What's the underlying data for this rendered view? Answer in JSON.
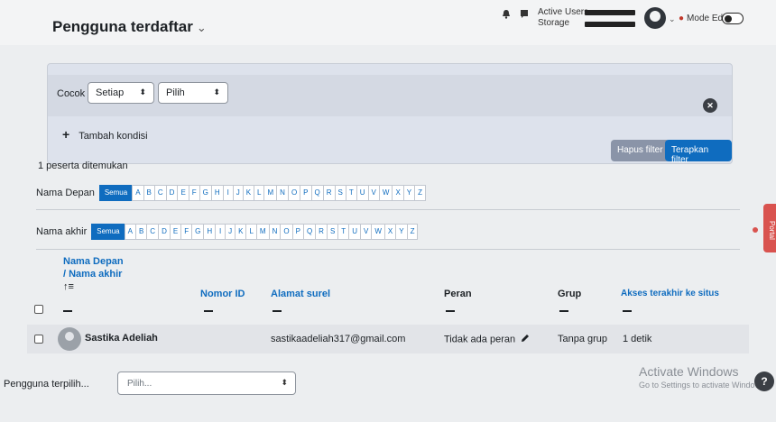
{
  "header": {
    "title": "Pengguna terdaftar",
    "title_caret": "⌄",
    "usage_active_label": "Active Users",
    "usage_storage_label": "Storage",
    "avatar_caret": "⌄",
    "mode_edit_label": "Mode Edit"
  },
  "filter": {
    "match_label": "Cocok",
    "match_value": "Setiap",
    "condition_value": "Pilih",
    "add_condition_label": "Tambah kondisi",
    "clear_button": "Hapus filter",
    "apply_button": "Terapkan filter"
  },
  "results": {
    "found_text": "1 peserta ditemukan"
  },
  "alphabet": {
    "first_name_label": "Nama Depan",
    "last_name_label": "Nama akhir",
    "all_label": "Semua",
    "letters": [
      "A",
      "B",
      "C",
      "D",
      "E",
      "F",
      "G",
      "H",
      "I",
      "J",
      "K",
      "L",
      "M",
      "N",
      "O",
      "P",
      "Q",
      "R",
      "S",
      "T",
      "U",
      "V",
      "W",
      "X",
      "Y",
      "Z"
    ]
  },
  "table": {
    "headers": {
      "name_line1": "Nama Depan",
      "name_line2": "/ Nama akhir",
      "sort_icon": "↑≡",
      "id_number": "Nomor ID",
      "email": "Alamat surel",
      "role": "Peran",
      "group": "Grup",
      "last_access": "Akses terakhir ke situs"
    },
    "rows": [
      {
        "name": "Sastika Adeliah",
        "email": "sastikaadeliah317@gmail.com",
        "role": "Tidak ada peran",
        "group": "Tanpa grup",
        "last_access": "1 detik"
      }
    ]
  },
  "footer": {
    "bulk_label": "Pengguna terpilih...",
    "bulk_placeholder": "Pilih...",
    "windows_title": "Activate Windows",
    "windows_subtitle": "Go to Settings to activate Windows.",
    "help": "?"
  },
  "portal_tab": "Portal",
  "colors": {
    "primary": "#0f6cbf",
    "filter_panel": "#dde2ec",
    "clear_button": "#8a94a8",
    "danger": "#d9534f"
  },
  "icons": {
    "notifications": "bell-icon",
    "messages": "chat-icon",
    "edit_role": "pencil-icon"
  }
}
